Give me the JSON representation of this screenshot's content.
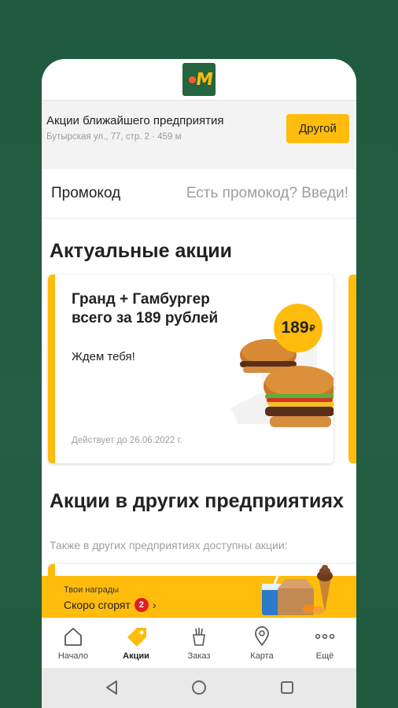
{
  "header": {
    "logo": "M"
  },
  "nearest": {
    "title": "Акции ближайшего предприятия",
    "address": "Бутырская ул., 77, стр. 2 · 459 м",
    "other_button": "Другой"
  },
  "promo": {
    "label": "Промокод",
    "hint": "Есть промокод? Введи!"
  },
  "current": {
    "section_title": "Актуальные акции",
    "card": {
      "title": "Гранд + Гамбургер всего за 189 рублей",
      "subtitle": "Ждем тебя!",
      "valid": "Действует до 26.06.2022 г.",
      "price": "189",
      "currency": "₽"
    }
  },
  "others": {
    "section_title": "Акции в других предприятиях",
    "hint": "Также в других предприятиях доступны акции:"
  },
  "rewards": {
    "small": "Твои награды",
    "big": "Скоро сгорят",
    "count": "2"
  },
  "tabs": [
    {
      "label": "Начало",
      "icon": "home-icon"
    },
    {
      "label": "Акции",
      "icon": "tag-icon",
      "active": true
    },
    {
      "label": "Заказ",
      "icon": "fries-icon"
    },
    {
      "label": "Карта",
      "icon": "map-pin-icon"
    },
    {
      "label": "Ещё",
      "icon": "more-icon"
    }
  ],
  "colors": {
    "brand_yellow": "#ffbc0d",
    "brand_green": "#24643f",
    "badge_red": "#e01e26"
  }
}
